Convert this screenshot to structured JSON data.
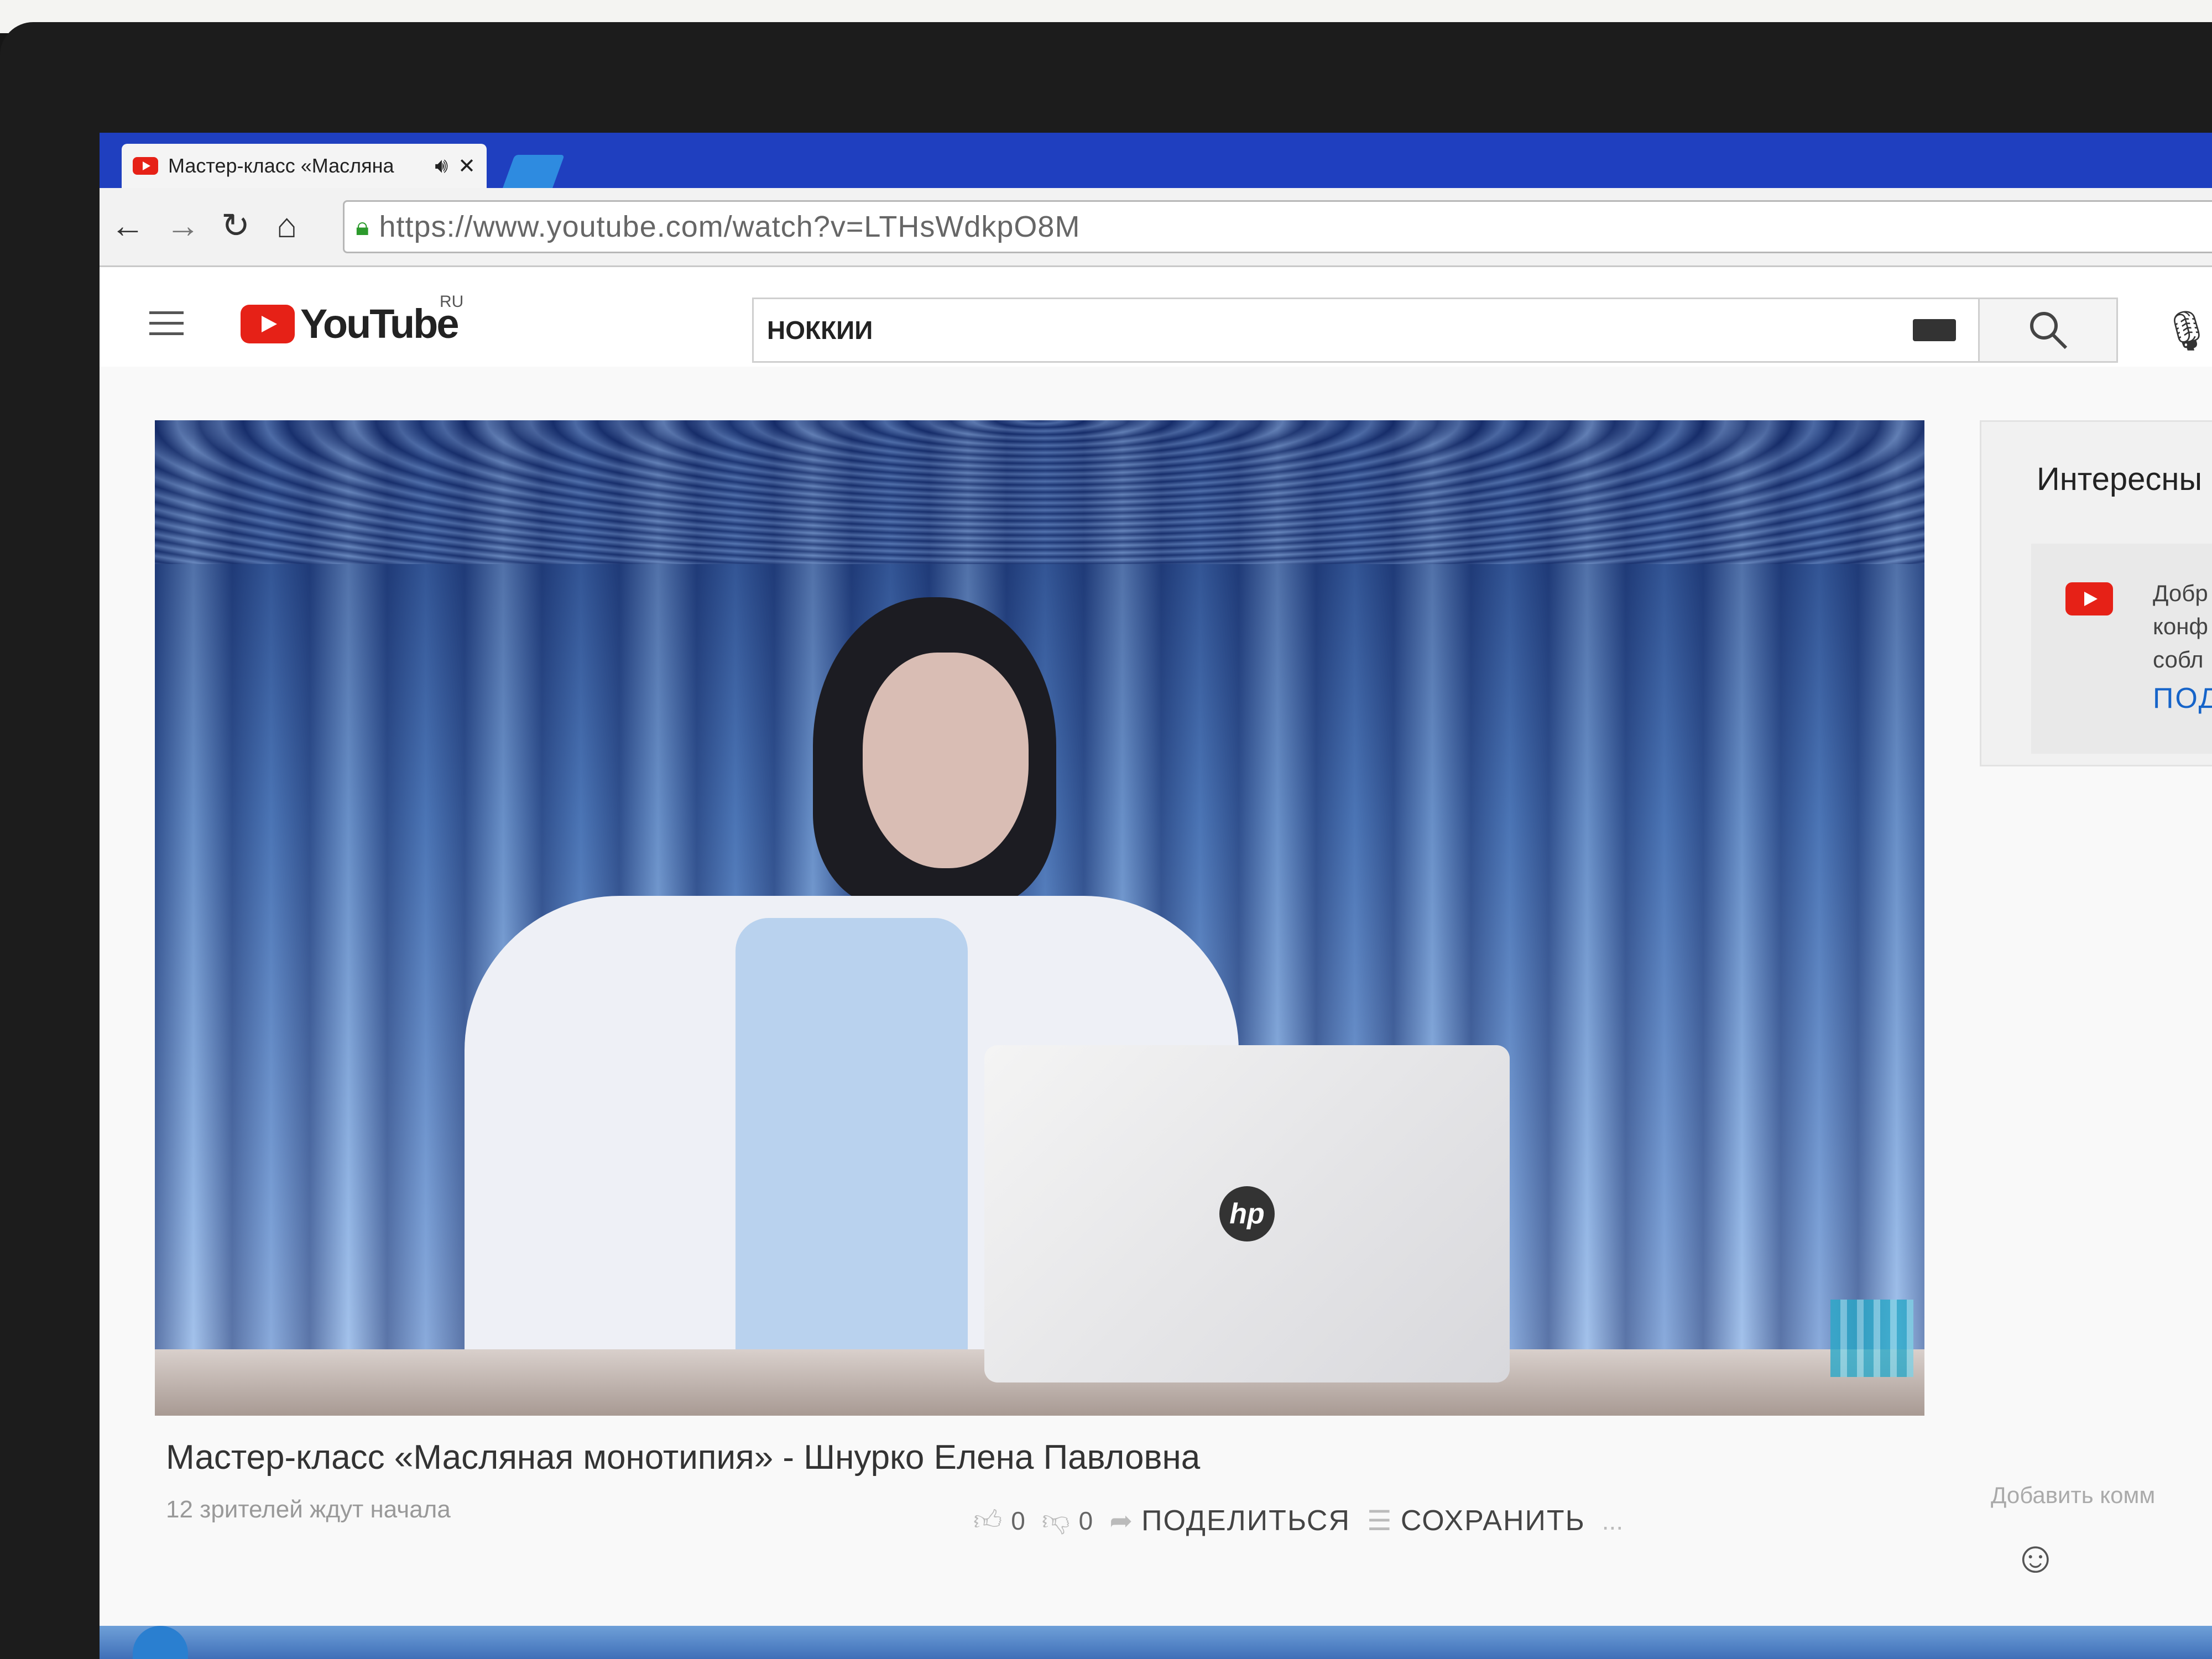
{
  "browser": {
    "tab_title": "Мастер-класс «Масляна",
    "url": "https://www.youtube.com/watch?v=LTHsWdkpO8M"
  },
  "youtube": {
    "logo_text": "YouTube",
    "region": "RU",
    "search_query": "НОККИИ"
  },
  "video": {
    "title": "Мастер-класс «Масляная монотипия» - Шнурко Елена Павловна",
    "viewers": "12 зрителей ждут начала",
    "likes": "0",
    "dislikes": "0",
    "share_label": "ПОДЕЛИТЬСЯ",
    "save_label": "СОХРАНИТЬ",
    "more": "...",
    "laptop_brand": "hp"
  },
  "sidebar": {
    "heading": "Интересны",
    "notice_text": "Добр\nконф\nсобл",
    "notice_link": "ПОД"
  },
  "chat": {
    "placeholder": "Добавить комм"
  },
  "colors": {
    "tab_bar": "#1f3fbf",
    "youtube_red": "#e62117",
    "link_blue": "#1664c9"
  }
}
